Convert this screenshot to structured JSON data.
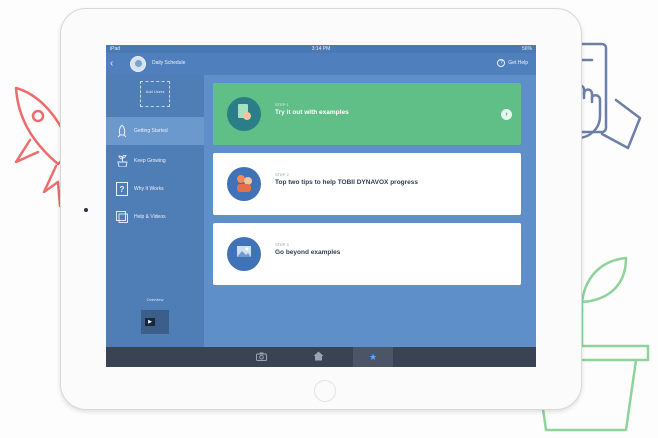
{
  "statusbar": {
    "carrier": "iPad",
    "time": "3:14 PM",
    "battery": "56%"
  },
  "appbar": {
    "title": "Daily Schedule",
    "help_label": "Get Help"
  },
  "sidebar": {
    "qr_text": "Add Users",
    "items": [
      {
        "label": "Getting Started",
        "icon": "rocket-icon",
        "active": true
      },
      {
        "label": "Keep Growing",
        "icon": "plant-icon",
        "active": false
      },
      {
        "label": "Why It Works",
        "icon": "question-icon",
        "active": false
      },
      {
        "label": "Help & Videos",
        "icon": "video-icon",
        "active": false
      }
    ],
    "video_label": "Overview"
  },
  "cards": [
    {
      "step": "STEP 1",
      "title": "Try it out with examples",
      "icon": "tablet-hand-icon",
      "highlighted": true
    },
    {
      "step": "STEP 2",
      "title": "Top two tips to help TOBII DYNAVOX progress",
      "icon": "people-icon",
      "highlighted": false
    },
    {
      "step": "STEP 3",
      "title": "Go beyond examples",
      "icon": "picture-icon",
      "highlighted": false
    }
  ],
  "tabs": [
    {
      "icon": "camera-icon",
      "active": false
    },
    {
      "icon": "home-icon",
      "active": false
    },
    {
      "icon": "star-icon",
      "active": true
    }
  ],
  "colors": {
    "screen_bg": "#5e8fc9",
    "sidebar_bg": "#4f7db6",
    "highlight_green": "#5fbf86",
    "tabbar_bg": "#3a4352",
    "rocket_stroke": "#ee6c6c",
    "hand_stroke": "#6b7fa8",
    "plant_stroke": "#8ed39a"
  }
}
